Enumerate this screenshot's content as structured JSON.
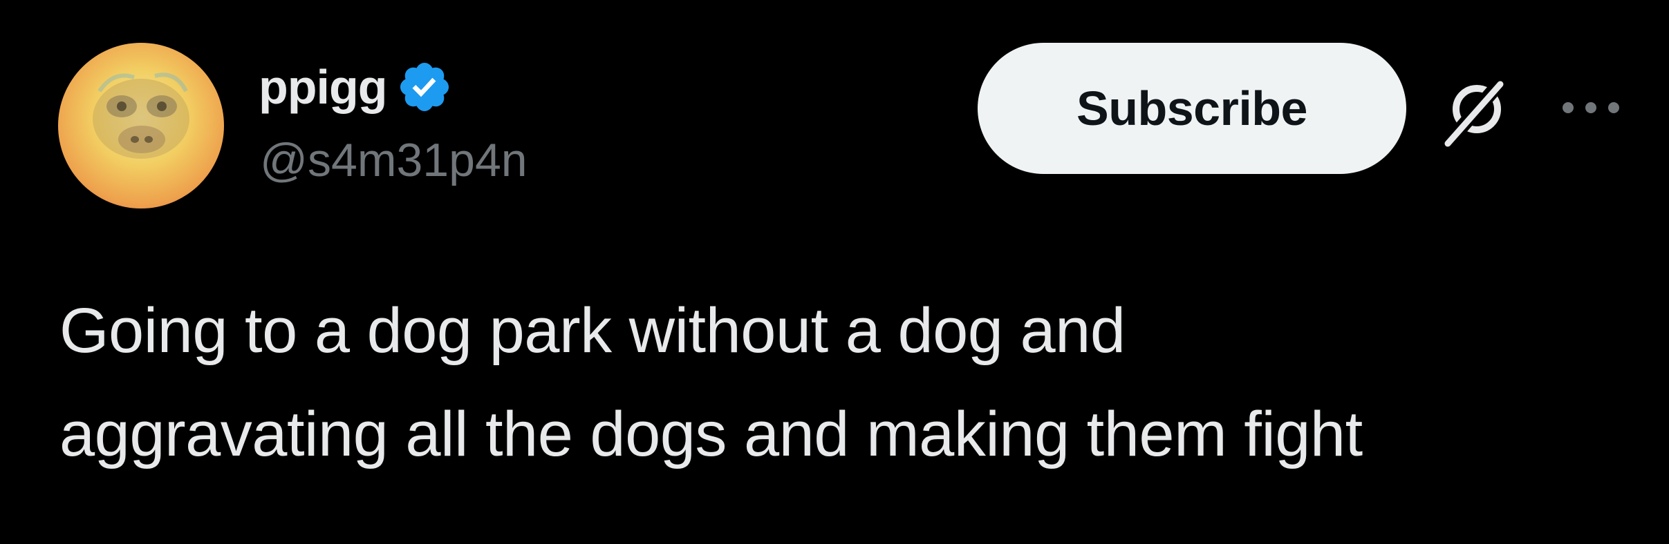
{
  "author": {
    "display_name": "ppigg",
    "handle": "@s4m31p4n",
    "verified": true
  },
  "actions": {
    "subscribe_label": "Subscribe",
    "grok_icon": "grok-icon",
    "more_icon": "more-horizontal-icon"
  },
  "tweet": {
    "lines": [
      "Going to a dog park without a dog and",
      "aggravating all the dogs and making them fight"
    ]
  },
  "colors": {
    "background": "#000000",
    "text_primary": "#e7e9ea",
    "text_secondary": "#71767b",
    "verified_badge": "#1d9bf0",
    "subscribe_bg": "#eff3f4",
    "subscribe_text": "#0f1419"
  }
}
